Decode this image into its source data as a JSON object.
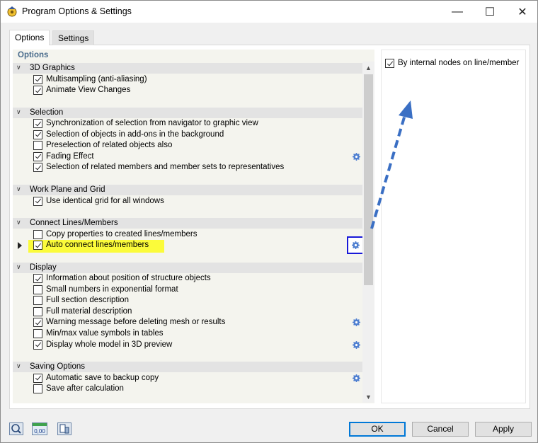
{
  "window": {
    "title": "Program Options & Settings",
    "minimize_glyph": "—",
    "maximize_glyph": "☐",
    "close_glyph": "✕"
  },
  "tabs": [
    {
      "label": "Options",
      "active": true
    },
    {
      "label": "Settings",
      "active": false
    }
  ],
  "options_header": "Options",
  "groups": [
    {
      "title": "3D Graphics",
      "items": [
        {
          "label": "Multisampling (anti-aliasing)",
          "checked": true,
          "gear": false
        },
        {
          "label": "Animate View Changes",
          "checked": true,
          "gear": false
        }
      ]
    },
    {
      "title": "Selection",
      "items": [
        {
          "label": "Synchronization of selection from navigator to graphic view",
          "checked": true,
          "gear": false
        },
        {
          "label": "Selection of objects in add-ons in the background",
          "checked": true,
          "gear": false
        },
        {
          "label": "Preselection of related objects also",
          "checked": false,
          "gear": false
        },
        {
          "label": "Fading Effect",
          "checked": true,
          "gear": true
        },
        {
          "label": "Selection of related members and member sets to representatives",
          "checked": true,
          "gear": false
        }
      ]
    },
    {
      "title": "Work Plane and Grid",
      "items": [
        {
          "label": "Use identical grid for all windows",
          "checked": true,
          "gear": false
        }
      ]
    },
    {
      "title": "Connect Lines/Members",
      "items": [
        {
          "label": "Copy properties to created lines/members",
          "checked": false,
          "gear": false
        },
        {
          "label": "Auto connect lines/members",
          "checked": true,
          "gear": true,
          "selected": true
        }
      ]
    },
    {
      "title": "Display",
      "items": [
        {
          "label": "Information about position of structure objects",
          "checked": true,
          "gear": false
        },
        {
          "label": "Small numbers in exponential format",
          "checked": false,
          "gear": false
        },
        {
          "label": "Full section description",
          "checked": false,
          "gear": false
        },
        {
          "label": "Full material description",
          "checked": false,
          "gear": false
        },
        {
          "label": "Warning message before deleting mesh or results",
          "checked": true,
          "gear": true
        },
        {
          "label": "Min/max value symbols in tables",
          "checked": false,
          "gear": false
        },
        {
          "label": "Display whole model in 3D preview",
          "checked": true,
          "gear": true
        }
      ]
    },
    {
      "title": "Saving Options",
      "items": [
        {
          "label": "Automatic save to backup copy",
          "checked": true,
          "gear": true
        },
        {
          "label": "Save after calculation",
          "checked": false,
          "gear": false
        }
      ]
    }
  ],
  "detail": {
    "label": "By internal nodes on line/member",
    "checked": true
  },
  "footer": {
    "ok_label": "OK",
    "cancel_label": "Cancel",
    "apply_label": "Apply",
    "icons": [
      "help-icon",
      "units-icon",
      "device-settings-icon"
    ],
    "units_icon_text": "0,00"
  },
  "colors": {
    "highlight": "#fbfb3a",
    "group_header": "#e3e3e3",
    "frame_blue": "#1919d8",
    "arrow_blue": "#3a6fc4",
    "options_header": "#4a6c8c"
  }
}
